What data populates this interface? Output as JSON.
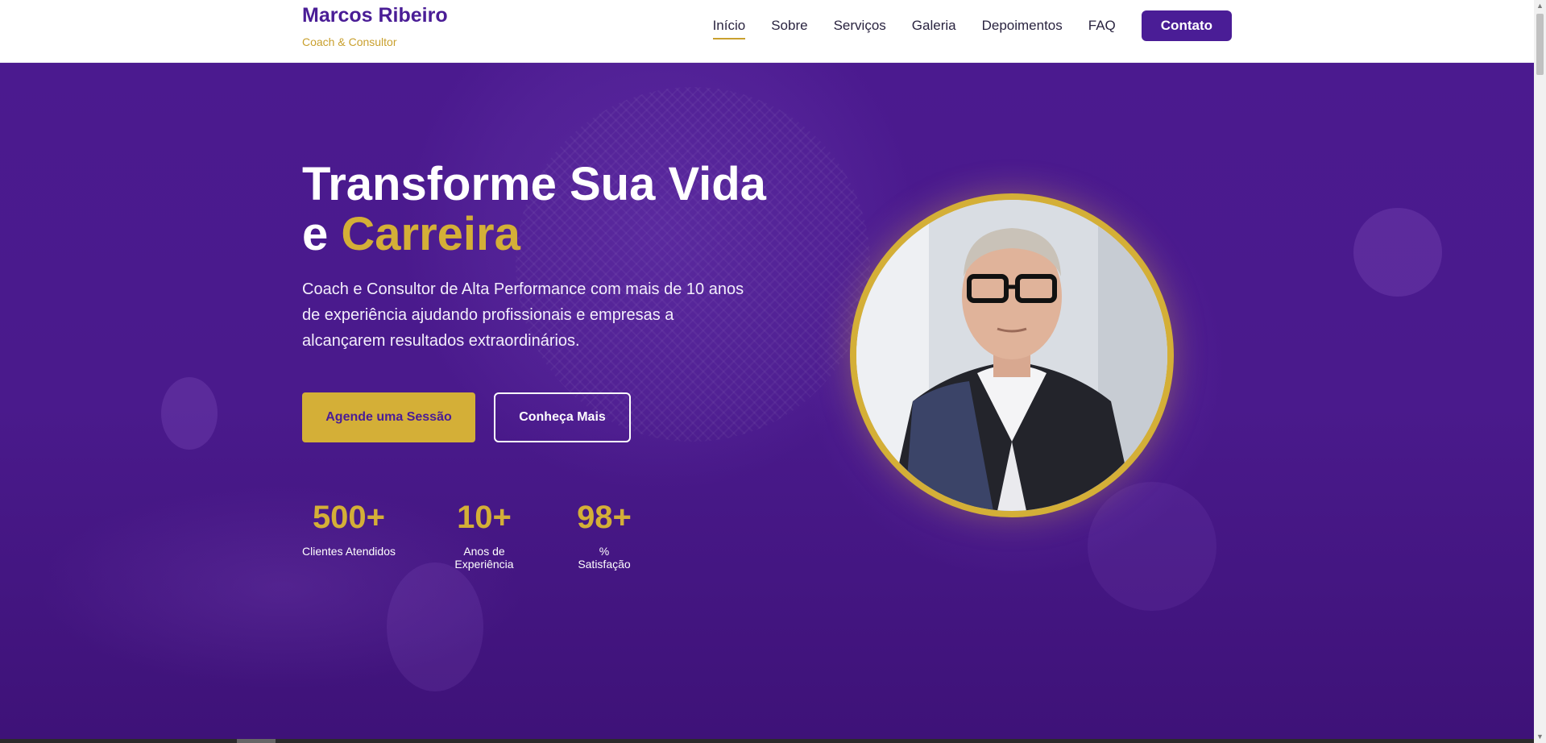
{
  "brand": {
    "name": "Marcos Ribeiro",
    "subtitle": "Coach & Consultor"
  },
  "nav": {
    "items": [
      {
        "label": "Início",
        "active": true
      },
      {
        "label": "Sobre",
        "active": false
      },
      {
        "label": "Serviços",
        "active": false
      },
      {
        "label": "Galeria",
        "active": false
      },
      {
        "label": "Depoimentos",
        "active": false
      },
      {
        "label": "FAQ",
        "active": false
      }
    ],
    "contact_label": "Contato"
  },
  "hero": {
    "title_line1": "Transforme Sua Vida",
    "title_prefix": "e ",
    "title_accent": "Carreira",
    "description": "Coach e Consultor de Alta Performance com mais de 10 anos de experiência ajudando profissionais e empresas a alcançarem resultados extraordinários.",
    "primary_button": "Agende uma Sessão",
    "secondary_button": "Conheça Mais",
    "stats": [
      {
        "value": "500+",
        "label": "Clientes Atendidos"
      },
      {
        "value": "10+",
        "label": "Anos de Experiência"
      },
      {
        "value": "98+",
        "label": "% Satisfação"
      }
    ]
  },
  "colors": {
    "primary": "#4a1d96",
    "accent": "#d4af37",
    "hero_background": "#4b1a8f"
  },
  "icons": {
    "portrait": "person-photo",
    "scroll_up": "arrow-up-icon",
    "scroll_down": "arrow-down-icon"
  }
}
